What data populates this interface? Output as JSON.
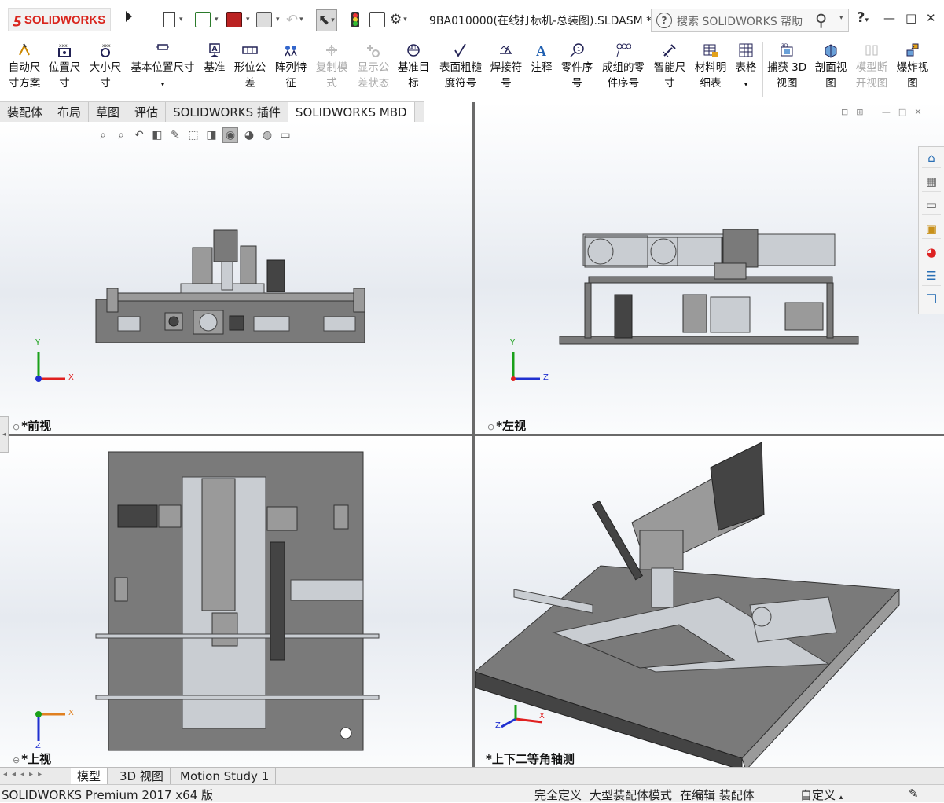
{
  "titlebar": {
    "brand": "SOLIDWORKS",
    "document_title": "9BA010000(在线打标机-总装图).SLDASM *",
    "search_placeholder": "搜索 SOLIDWORKS 帮助",
    "help": "?",
    "minimize": "—",
    "restore": "□",
    "close": "✕"
  },
  "ribbon": {
    "items": [
      {
        "label1": "自动尺",
        "label2": "寸方案",
        "disabled": false
      },
      {
        "label1": "位置尺",
        "label2": "寸",
        "disabled": false
      },
      {
        "label1": "大小尺",
        "label2": "寸",
        "disabled": false
      },
      {
        "label1": "基本位置尺寸",
        "label2": "▾",
        "disabled": false
      },
      {
        "label1": "基准",
        "label2": "",
        "disabled": false
      },
      {
        "label1": "形位公",
        "label2": "差",
        "disabled": false
      },
      {
        "label1": "阵列特",
        "label2": "征",
        "disabled": false
      },
      {
        "label1": "复制模",
        "label2": "式",
        "disabled": true
      },
      {
        "label1": "显示公",
        "label2": "差状态",
        "disabled": true
      },
      {
        "label1": "基准目",
        "label2": "标",
        "disabled": false
      },
      {
        "label1": "表面粗糙",
        "label2": "度符号",
        "disabled": false
      },
      {
        "label1": "焊接符",
        "label2": "号",
        "disabled": false
      },
      {
        "label1": "注释",
        "label2": "",
        "disabled": false
      },
      {
        "label1": "零件序",
        "label2": "号",
        "disabled": false
      },
      {
        "label1": "成组的零",
        "label2": "件序号",
        "disabled": false
      },
      {
        "label1": "智能尺",
        "label2": "寸",
        "disabled": false
      },
      {
        "label1": "材料明",
        "label2": "细表",
        "disabled": false
      },
      {
        "label1": "表格",
        "label2": "▾",
        "disabled": false
      },
      {
        "label1": "捕获 3D",
        "label2": "视图",
        "disabled": false
      },
      {
        "label1": "剖面视",
        "label2": "图",
        "disabled": false
      },
      {
        "label1": "模型断",
        "label2": "开视图",
        "disabled": true
      },
      {
        "label1": "爆炸视",
        "label2": "图",
        "disabled": false
      }
    ]
  },
  "tabs": [
    {
      "label": "装配体",
      "active": false
    },
    {
      "label": "布局",
      "active": false
    },
    {
      "label": "草图",
      "active": false
    },
    {
      "label": "评估",
      "active": false
    },
    {
      "label": "SOLIDWORKS 插件",
      "active": false
    },
    {
      "label": "SOLIDWORKS MBD",
      "active": true
    }
  ],
  "viewports": {
    "front": {
      "label": "*前视",
      "axis_x": "X",
      "axis_y": "Y"
    },
    "left": {
      "label": "*左视",
      "axis_x": "Z",
      "axis_y": "Y"
    },
    "top": {
      "label": "*上视",
      "axis_x": "X",
      "axis_y": "Z"
    },
    "iso": {
      "label": "*上下二等角轴测",
      "axis_x": "X",
      "axis_y": "Z"
    }
  },
  "bottom_tabs": [
    {
      "label": "模型",
      "active": true
    },
    {
      "label": "3D 视图",
      "active": false
    },
    {
      "label": "Motion Study 1",
      "active": false
    }
  ],
  "status": {
    "product": "SOLIDWORKS Premium 2017 x64 版",
    "s1": "完全定义",
    "s2": "大型装配体模式",
    "s3": "在编辑 装配体",
    "s4": "自定义"
  },
  "colors": {
    "brand": "#d9251d",
    "axis_x": "#e02020",
    "axis_y": "#1aa01a",
    "axis_z": "#2030d0"
  }
}
